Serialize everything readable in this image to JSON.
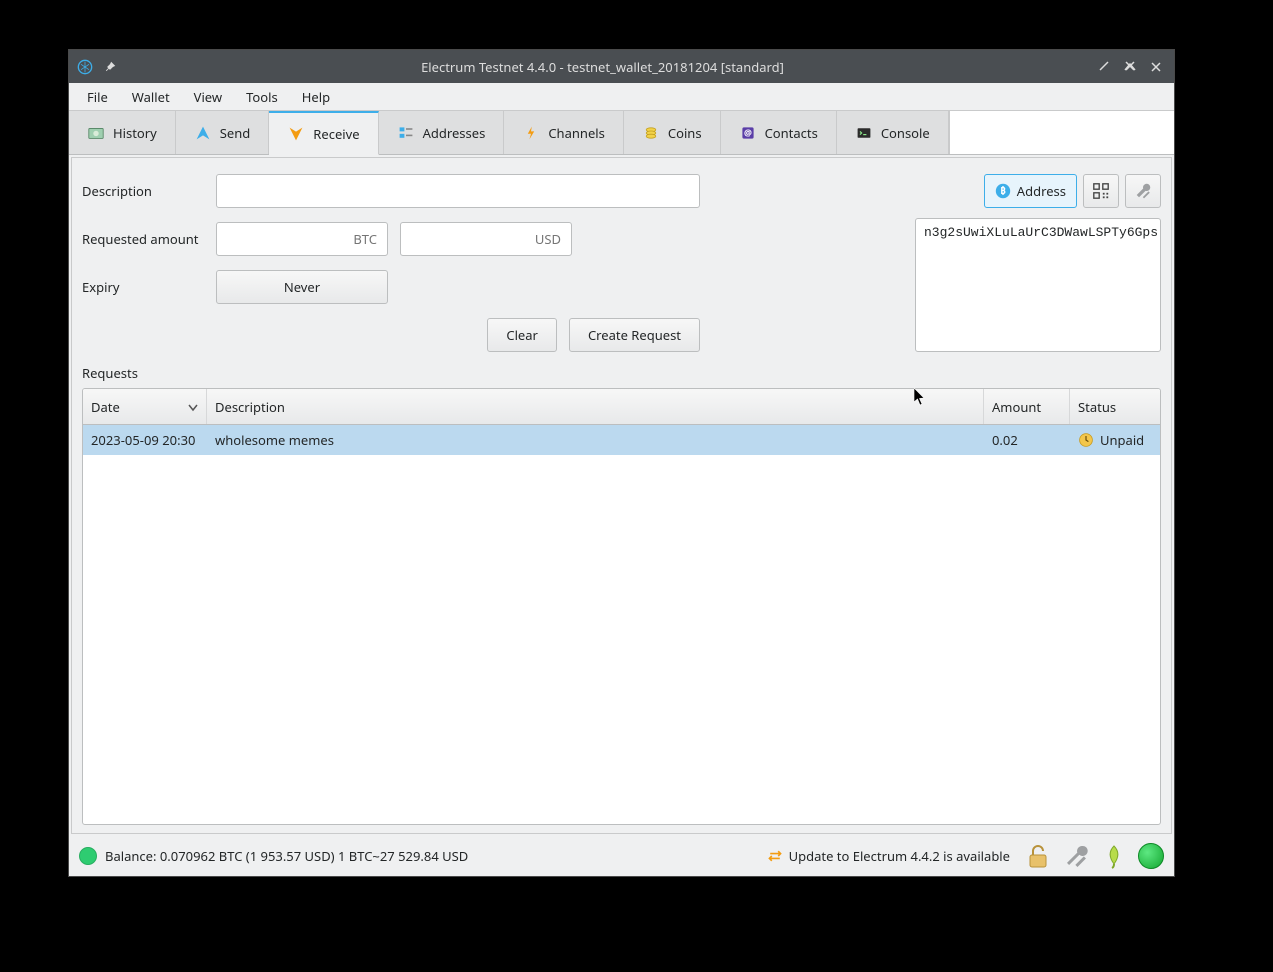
{
  "window": {
    "title": "Electrum Testnet 4.4.0 - testnet_wallet_20181204 [standard]"
  },
  "menubar": [
    "File",
    "Wallet",
    "View",
    "Tools",
    "Help"
  ],
  "tabs": [
    {
      "label": "History"
    },
    {
      "label": "Send"
    },
    {
      "label": "Receive"
    },
    {
      "label": "Addresses"
    },
    {
      "label": "Channels"
    },
    {
      "label": "Coins"
    },
    {
      "label": "Contacts"
    },
    {
      "label": "Console"
    }
  ],
  "form": {
    "description_label": "Description",
    "description_value": "",
    "amount_label": "Requested amount",
    "btc_placeholder": "BTC",
    "usd_placeholder": "USD",
    "expiry_label": "Expiry",
    "expiry_value": "Never",
    "clear_button": "Clear",
    "create_button": "Create Request"
  },
  "side": {
    "address_button": "Address",
    "address_value": "n3g2sUwiXLuLaUrC3DWawLSPTy6Gps"
  },
  "requests": {
    "section_label": "Requests",
    "columns": {
      "date": "Date",
      "description": "Description",
      "amount": "Amount",
      "status": "Status"
    },
    "rows": [
      {
        "date": "2023-05-09 20:30",
        "description": "wholesome memes",
        "amount": "0.02",
        "status": "Unpaid"
      }
    ]
  },
  "statusbar": {
    "balance": "Balance: 0.070962 BTC (1 953.57 USD)  1 BTC~27 529.84 USD",
    "update": "Update to Electrum 4.4.2 is available"
  }
}
